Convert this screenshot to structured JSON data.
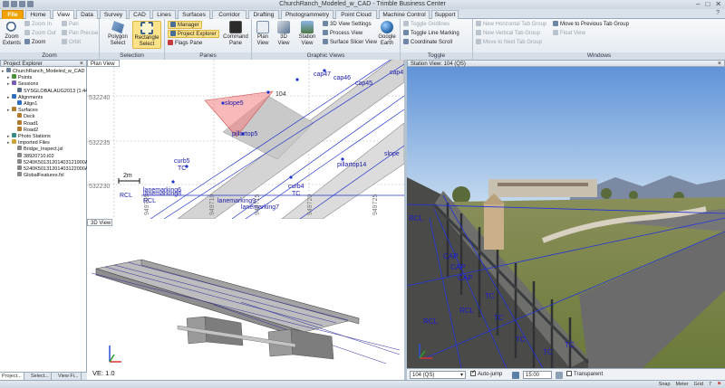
{
  "app": {
    "title": "ChurchRanch_Modeled_w_CAD - Trimble Business Center"
  },
  "window_controls": {
    "minimize": "–",
    "maximize": "□",
    "close": "✕"
  },
  "tabs": [
    "File",
    "Home",
    "View",
    "Data",
    "Survey",
    "CAD",
    "Lines",
    "Surfaces",
    "Corridor",
    "Drafting",
    "Photogrammetry",
    "Point Cloud",
    "Machine Control",
    "Support"
  ],
  "active_tab": "View",
  "ribbon": {
    "zoom": {
      "label": "Zoom",
      "zoom_extents": "Zoom Extents",
      "zoom_in": "Zoom In",
      "zoom_out": "Zoom Out",
      "zoom": "Zoom",
      "pan": "Pan",
      "pan_precise": "Pan Precise",
      "orbit": "Orbit"
    },
    "selection": {
      "label": "Selection",
      "polygon_select": "Polygon Select",
      "rectangle_select": "Rectangle Select"
    },
    "panes": {
      "label": "Panes",
      "manager": "Manager",
      "project_explorer": "Project Explorer",
      "flags_pane": "Flags Pane",
      "command_pane": "Command Pane"
    },
    "graphic_views": {
      "label": "Graphic Views",
      "plan_view": "Plan View",
      "view_3d": "3D View",
      "station_view": "Station View",
      "settings_3d": "3D View Settings",
      "process_view": "Process View",
      "surface_slicer": "Surface Slicer View",
      "google_earth": "Google Earth"
    },
    "toggle": {
      "label": "Toggle",
      "toggle_gridlines": "Toggle Gridlines",
      "toggle_line_marking": "Toggle Line Marking",
      "coordinate_scroll": "Coordinate Scroll"
    },
    "windows": {
      "label": "Windows",
      "new_horizontal": "New Horizontal Tab Group",
      "new_vertical": "New Vertical Tab Group",
      "move_next": "Move to Next Tab Group",
      "move_previous": "Move to Previous Tab Group",
      "float_view": "Float View"
    }
  },
  "explorer": {
    "title": "Project Explorer",
    "nodes": [
      {
        "label": "ChurchRanch_Modeled_w_CAD",
        "color": "#6a7f99",
        "indent": 0
      },
      {
        "label": "Points",
        "color": "#4a8f3a",
        "indent": 1
      },
      {
        "label": "Sessions",
        "color": "#7a5fb0",
        "indent": 1
      },
      {
        "label": "SYSGLOBALAUG2013 (1:44 ...",
        "color": "#5c6f88",
        "indent": 2
      },
      {
        "label": "Alignments",
        "color": "#2f6fc0",
        "indent": 1
      },
      {
        "label": "Align1",
        "color": "#2f6fc0",
        "indent": 2
      },
      {
        "label": "Surfaces",
        "color": "#b07a30",
        "indent": 1
      },
      {
        "label": "Deck",
        "color": "#b07a30",
        "indent": 2
      },
      {
        "label": "Road1",
        "color": "#b07a30",
        "indent": 2
      },
      {
        "label": "Road2",
        "color": "#b07a30",
        "indent": 2
      },
      {
        "label": "Photo Stations",
        "color": "#3b8a8a",
        "indent": 1
      },
      {
        "label": "Imported Files",
        "color": "#c9a23a",
        "indent": 1
      },
      {
        "label": "Bridge_Inspect.jxl",
        "color": "#888",
        "indent": 2
      },
      {
        "label": "38920710.t02",
        "color": "#888",
        "indent": 2
      },
      {
        "label": "5240K50131201403121900A...",
        "color": "#888",
        "indent": 2
      },
      {
        "label": "5240K50131201403122000A...",
        "color": "#888",
        "indent": 2
      },
      {
        "label": "GlobalFeatures.fxl",
        "color": "#888",
        "indent": 2
      }
    ],
    "bottom_tabs": [
      "Project...",
      "Select...",
      "View Fi..."
    ]
  },
  "plan_view": {
    "title": "Plan View",
    "northing_labels": [
      "532240",
      "532235",
      "532230"
    ],
    "easting_labels": [
      "949705",
      "949710",
      "949715",
      "949720",
      "949725"
    ],
    "scale_bar": "2m",
    "labels": {
      "cap47": "cap47",
      "cap46": "cap46",
      "cap45": "cap45",
      "cap44": "cap4",
      "n104": "104",
      "slope5": "slope5",
      "pillartop5": "pillartop5",
      "pillartop14": "pillartop14",
      "slope_r": "slope",
      "curb5": "curb5",
      "tc1": "TC",
      "rcl1": "RCL",
      "rcl2": "RCL",
      "lm6": "lanemarking6",
      "lm8": "lanemarking8",
      "lm7": "lanemarking7",
      "lm9": "lanemarking9",
      "curb4": "curb4",
      "tc2": "TC"
    }
  },
  "view_3d": {
    "title": "3D View",
    "ve": "VE: 1.0"
  },
  "station_view": {
    "title": "Station View: 104 (QS)",
    "overlay_labels": [
      "RCL",
      "CAP",
      "CAP",
      "CAP",
      "TC",
      "TC",
      "RCL",
      "TC",
      "TC",
      "TC",
      "RCL"
    ],
    "controls": {
      "station": "104 (QS)",
      "auto_jump": "Auto-jump",
      "auto_jump_checked": true,
      "time": "15:00",
      "transparent": "Transparent",
      "transparent_checked": false
    }
  },
  "status": {
    "snap": "Snap",
    "units": "Meter",
    "grid": "Grid",
    "count": "7"
  }
}
